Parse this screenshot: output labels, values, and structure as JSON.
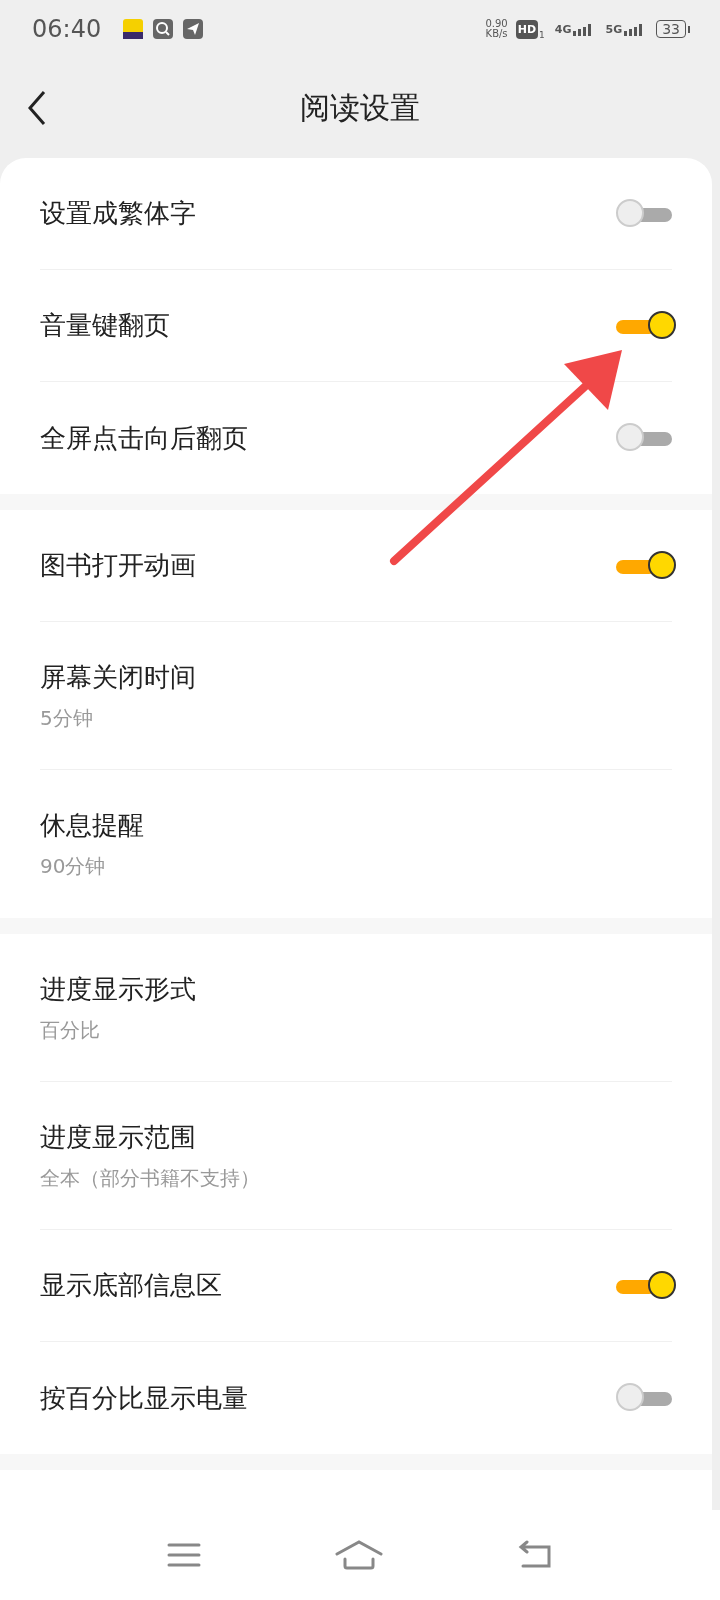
{
  "status_bar": {
    "time": "06:40",
    "speed_value": "0.90",
    "speed_unit": "KB/s",
    "hd": "HD",
    "hd_sub": "1",
    "net1": "4G",
    "net2": "5G",
    "battery": "33"
  },
  "header": {
    "title": "阅读设置"
  },
  "sections": [
    {
      "items": [
        {
          "kind": "toggle",
          "title": "设置成繁体字",
          "on": false
        },
        {
          "kind": "toggle",
          "title": "音量键翻页",
          "on": true
        },
        {
          "kind": "toggle",
          "title": "全屏点击向后翻页",
          "on": false
        }
      ]
    },
    {
      "items": [
        {
          "kind": "toggle",
          "title": "图书打开动画",
          "on": true
        },
        {
          "kind": "value",
          "title": "屏幕关闭时间",
          "subtitle": "5分钟"
        },
        {
          "kind": "value",
          "title": "休息提醒",
          "subtitle": "90分钟"
        }
      ]
    },
    {
      "items": [
        {
          "kind": "value",
          "title": "进度显示形式",
          "subtitle": "百分比"
        },
        {
          "kind": "value",
          "title": "进度显示范围",
          "subtitle": "全本（部分书籍不支持）"
        },
        {
          "kind": "toggle",
          "title": "显示底部信息区",
          "on": true
        },
        {
          "kind": "toggle",
          "title": "按百分比显示电量",
          "on": false
        }
      ]
    }
  ]
}
